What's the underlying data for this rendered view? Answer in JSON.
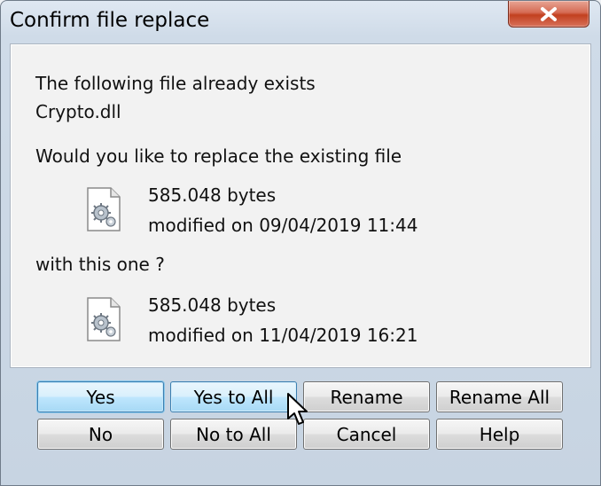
{
  "window": {
    "title": "Confirm file replace"
  },
  "icons": {
    "close": "close-icon",
    "file": "dll-file-icon",
    "cursor": "mouse-pointer-icon"
  },
  "message": {
    "line1": "The following file already exists",
    "filename": "Crypto.dll",
    "question": "Would you like to replace the existing file",
    "with_this": "with this one ?"
  },
  "existing_file": {
    "size": "585.048 bytes",
    "modified": "modified on 09/04/2019 11:44"
  },
  "new_file": {
    "size": "585.048 bytes",
    "modified": "modified on 11/04/2019 16:21"
  },
  "buttons": {
    "yes": "Yes",
    "yes_to_all": "Yes to All",
    "rename": "Rename",
    "rename_all": "Rename All",
    "no": "No",
    "no_to_all": "No to All",
    "cancel": "Cancel",
    "help": "Help"
  },
  "colors": {
    "close_button": "#c2401f",
    "default_button_border": "#3c7fb1"
  }
}
